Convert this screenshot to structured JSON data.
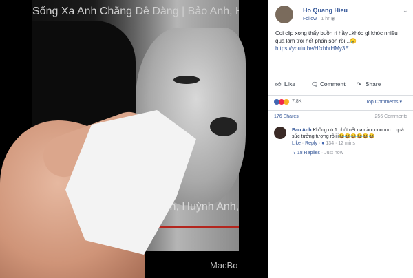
{
  "video": {
    "title_overlay": "Sống Xa Anh Chẳng Dễ Dàng | Bảo Anh, Huỳnh Anh, M",
    "caption": "Bảo Anh, Huỳnh Anh,",
    "device_label": "MacBo"
  },
  "post": {
    "author": "Ho Quang Hieu",
    "follow": "Follow",
    "time": "1 hr",
    "text": "Coi clip xong thấy buồn ri hầy...khóc gì khóc nhiều quá làm trôi hết phấn son rồi...😢",
    "link": "https://youtu.be/HfxhbrHMy3E"
  },
  "actions": {
    "like": "Like",
    "comment": "Comment",
    "share": "Share"
  },
  "reactions": {
    "count": "7.8K",
    "sort": "Top Comments ▾"
  },
  "counts": {
    "shares": "176 Shares",
    "comments": "256 Comments"
  },
  "top_comment": {
    "name": "Bao Anh",
    "text": "Không có 1 chút nết na nàoooooooo... quá sức tưởng tượng rồiiii😂😂😂😂😂😂",
    "like": "Like",
    "reply": "Reply",
    "reaction_count": "134",
    "time": "12 mins"
  },
  "replies": {
    "label": "18 Replies",
    "time": "Just now"
  },
  "colors": {
    "link": "#365899",
    "like_blue": "#4267b2",
    "love_red": "#f0284a",
    "haha_yellow": "#f7b125"
  }
}
